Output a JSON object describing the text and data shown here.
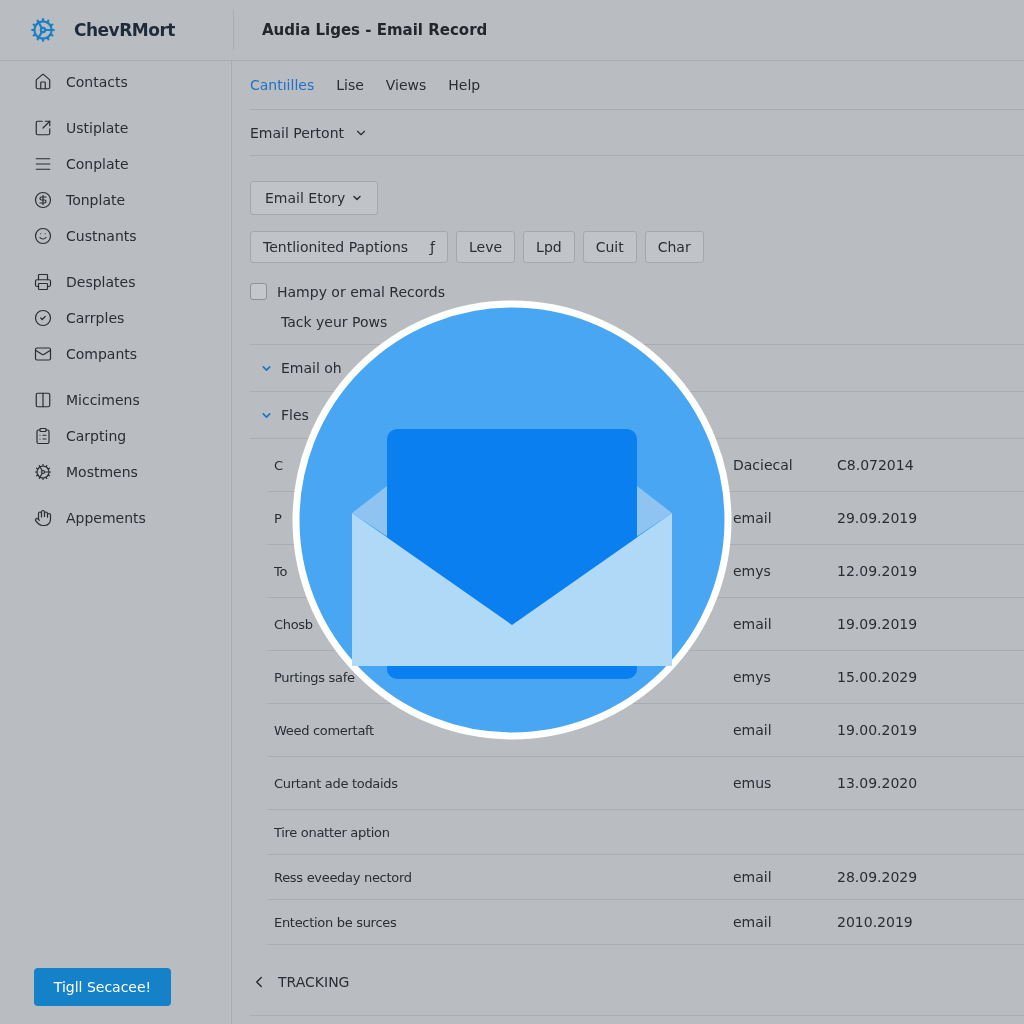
{
  "header": {
    "logo": "ChevRMort",
    "title": "Audia Liges - Email Record"
  },
  "sidebar": {
    "groups": [
      {
        "items": [
          "Contacts"
        ]
      },
      {
        "items": [
          "Ustiplate",
          "Conplate",
          "Tonplate",
          "Custnants"
        ]
      },
      {
        "items": [
          "Desplates",
          "Carrples",
          "Compants"
        ]
      },
      {
        "items": [
          "Miccimens",
          "Carpting",
          "Mostmens"
        ]
      },
      {
        "items": [
          "Appements"
        ]
      }
    ],
    "button": "Tigll Secacee!"
  },
  "menu": [
    {
      "label": "Cantıilles",
      "selected": true
    },
    {
      "label": "Lise",
      "selected": false
    },
    {
      "label": "Views",
      "selected": false
    },
    {
      "label": "Help",
      "selected": false
    }
  ],
  "section_dropdown": "Email Pertont",
  "story_dropdown": "Email Etory",
  "toolbar": [
    {
      "label": "Tentlionited Paptions",
      "glyph": "ƒ"
    },
    {
      "label": "Leve"
    },
    {
      "label": "Lpd"
    },
    {
      "label": "Cuit"
    },
    {
      "label": "Char"
    }
  ],
  "records_checkbox": {
    "label": "Hampy or emal Records",
    "checked": false
  },
  "subtitle": "Tack yeur Pows",
  "groups": [
    {
      "label": "Email oh",
      "expanded": true
    },
    {
      "label": "Fles",
      "expanded": true
    }
  ],
  "rows": [
    {
      "name": "C",
      "type": "Daciecal",
      "date": "C8.072014"
    },
    {
      "name": "P",
      "type": "email",
      "date": "29.09.2019"
    },
    {
      "name": "To",
      "type": "emys",
      "date": "12.09.2019"
    },
    {
      "name": "Chosb",
      "type": "email",
      "date": "19.09.2019"
    },
    {
      "name": "Purtings safe",
      "type": "emys",
      "date": "15.00.2029"
    },
    {
      "name": "Weed comertaft",
      "type": "email",
      "date": "19.00.2019"
    },
    {
      "name": "Curtant ade todaids",
      "type": "emus",
      "date": "13.09.2020"
    },
    {
      "name": "Tire onatter aption"
    },
    {
      "name": "Ress eveeday nectord",
      "type": "email",
      "date": "28.09.2029"
    },
    {
      "name": "Entection be surces",
      "type": "email",
      "date": "2010.2019"
    }
  ],
  "footer": {
    "link": "TRACKING"
  }
}
